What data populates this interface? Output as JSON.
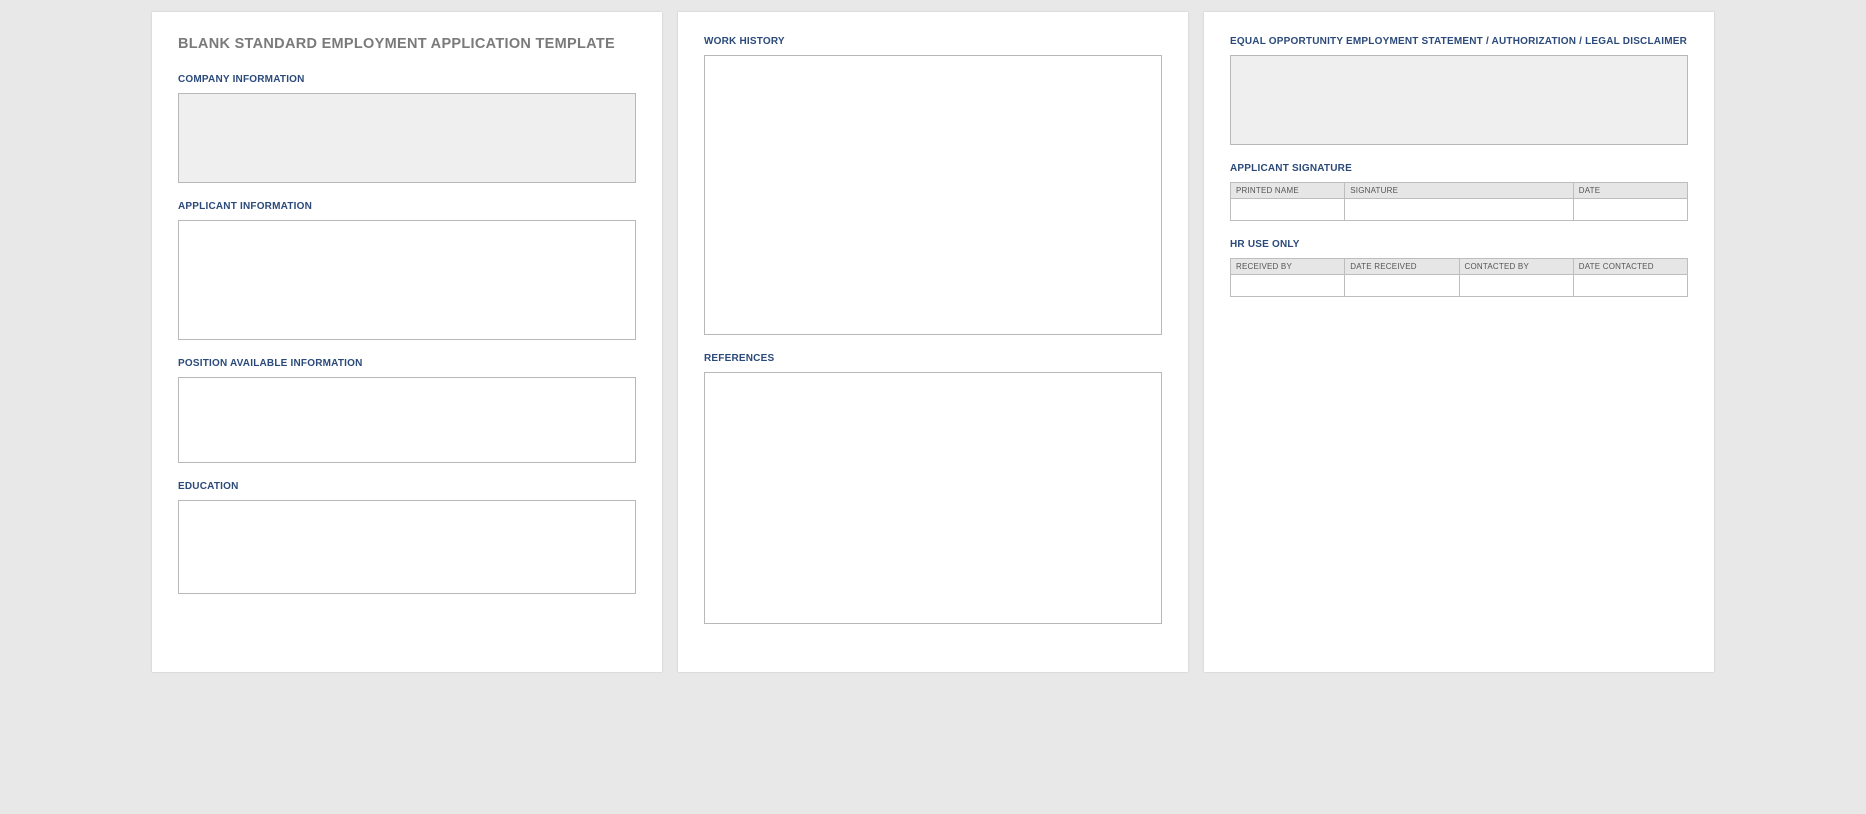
{
  "title": "BLANK STANDARD EMPLOYMENT APPLICATION TEMPLATE",
  "page1": {
    "sections": {
      "company_info": "COMPANY INFORMATION",
      "applicant_info": "APPLICANT INFORMATION",
      "position_info": "POSITION AVAILABLE INFORMATION",
      "education": "EDUCATION"
    }
  },
  "page2": {
    "sections": {
      "work_history": "WORK HISTORY",
      "references": "REFERENCES"
    }
  },
  "page3": {
    "sections": {
      "eoe": "EQUAL OPPORTUNITY EMPLOYMENT STATEMENT / AUTHORIZATION / LEGAL DISCLAIMER",
      "signature": "APPLICANT SIGNATURE",
      "hr": "HR USE ONLY"
    },
    "signature_table": {
      "cols": [
        "PRINTED NAME",
        "SIGNATURE",
        "DATE"
      ]
    },
    "hr_table": {
      "cols": [
        "RECEIVED BY",
        "DATE RECEIVED",
        "CONTACTED BY",
        "DATE CONTACTED"
      ]
    }
  }
}
